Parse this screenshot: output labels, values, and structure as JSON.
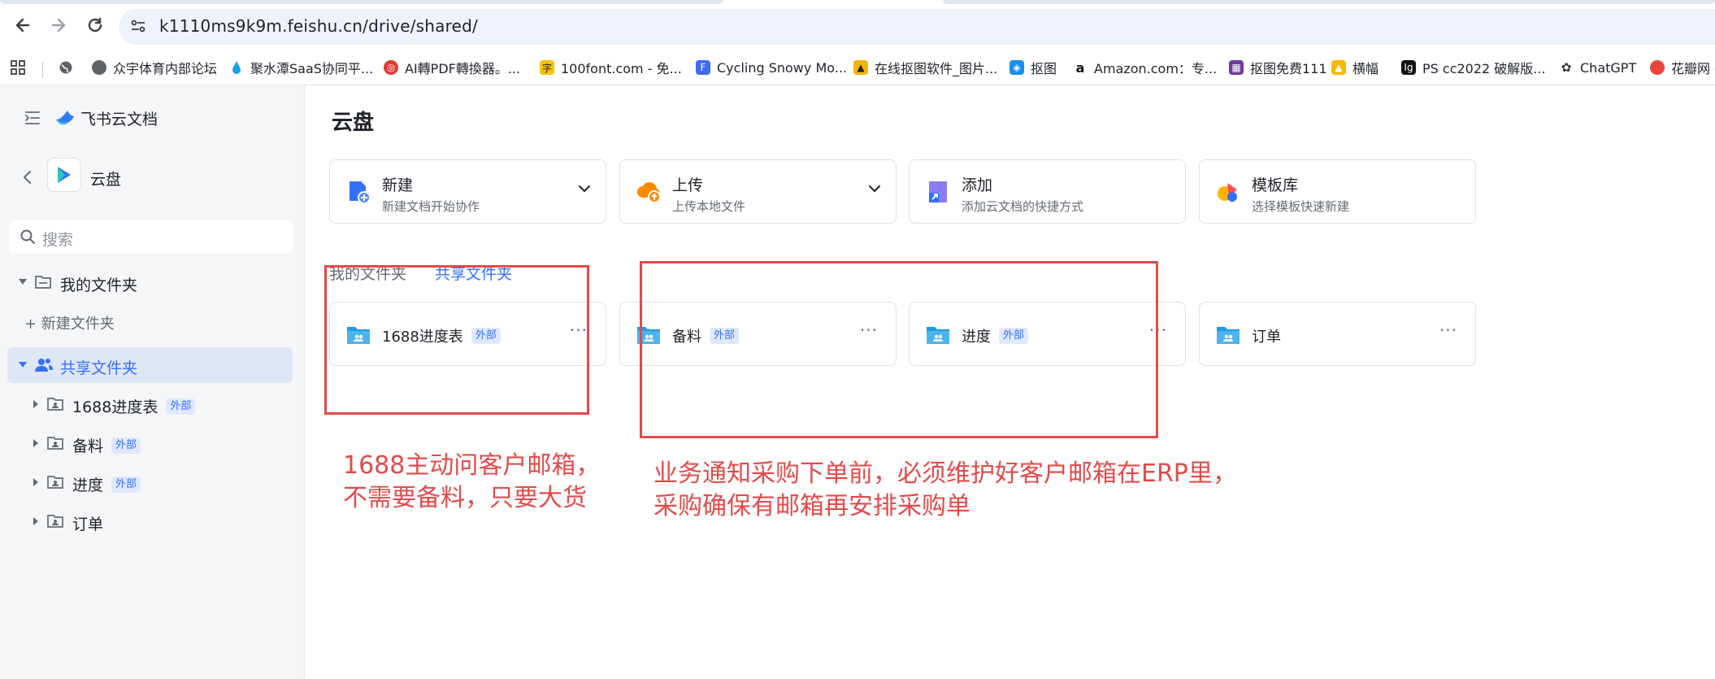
{
  "browser": {
    "url": "k1110ms9k9m.feishu.cn/drive/shared/",
    "bookmarks": [
      "众宇体育内部论坛",
      "聚水潭SaaS协同平...",
      "AI轉PDF轉換器。...",
      "100font.com - 免...",
      "Cycling Snowy Mo...",
      "在线抠图软件_图片...",
      "抠图",
      "Amazon.com：专...",
      "抠图免费111",
      "横幅",
      "PS cc2022 破解版...",
      "ChatGPT",
      "花瓣网 -"
    ]
  },
  "sidebar": {
    "app_name": "飞书云文档",
    "section_title": "云盘",
    "search_placeholder": "搜索",
    "my_folder": "我的文件夹",
    "new_folder": "+ 新建文件夹",
    "shared_folder": "共享文件夹",
    "external_badge": "外部",
    "tree_items": [
      {
        "label": "1688进度表",
        "badge": "外部"
      },
      {
        "label": "备料",
        "badge": "外部"
      },
      {
        "label": "进度",
        "badge": "外部"
      },
      {
        "label": "订单",
        "badge": ""
      }
    ]
  },
  "main": {
    "title": "云盘",
    "actions": [
      {
        "title": "新建",
        "subtitle": "新建文档开始协作"
      },
      {
        "title": "上传",
        "subtitle": "上传本地文件"
      },
      {
        "title": "添加",
        "subtitle": "添加云文档的快捷方式"
      },
      {
        "title": "模板库",
        "subtitle": "选择模板快速新建"
      }
    ],
    "tabs": [
      "我的文件夹",
      "共享文件夹"
    ],
    "folders": [
      {
        "name": "1688进度表",
        "badge": "外部"
      },
      {
        "name": "备料",
        "badge": "外部"
      },
      {
        "name": "进度",
        "badge": "外部"
      },
      {
        "name": "订单",
        "badge": ""
      }
    ],
    "more_label": "···"
  },
  "annotations": {
    "note1": [
      "1688主动问客户邮箱，",
      "不需要备料，只要大货"
    ],
    "note2": [
      "业务通知采购下单前，必须维护好客户邮箱在ERP里，",
      "采购确保有邮箱再安排采购单"
    ]
  },
  "colors": {
    "accent": "#3370ff",
    "annotation_red": "#e34a4a",
    "selected_bg": "#dfe6f5"
  }
}
